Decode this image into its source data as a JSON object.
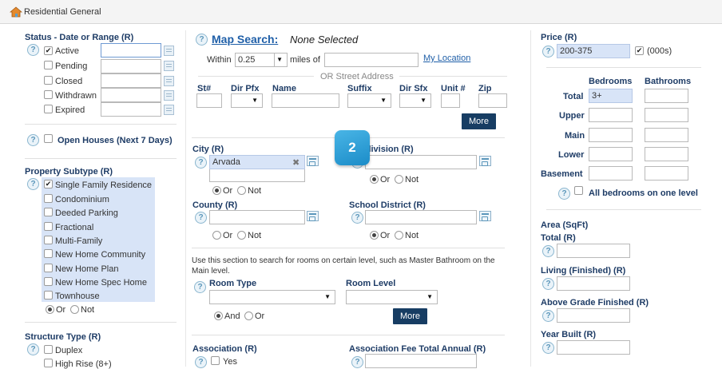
{
  "page": {
    "title": "Residential General"
  },
  "status": {
    "heading": "Status - Date or Range (R)",
    "items": [
      {
        "label": "Active",
        "checked": true
      },
      {
        "label": "Pending",
        "checked": false
      },
      {
        "label": "Closed",
        "checked": false
      },
      {
        "label": "Withdrawn",
        "checked": false
      },
      {
        "label": "Expired",
        "checked": false
      }
    ],
    "open_houses": "Open Houses (Next 7 Days)"
  },
  "subtype": {
    "heading": "Property Subtype (R)",
    "items": [
      {
        "label": "Single Family Residence",
        "checked": true
      },
      {
        "label": "Condominium",
        "checked": false
      },
      {
        "label": "Deeded Parking",
        "checked": false
      },
      {
        "label": "Fractional",
        "checked": false
      },
      {
        "label": "Multi-Family",
        "checked": false
      },
      {
        "label": "New Home Community",
        "checked": false
      },
      {
        "label": "New Home Plan",
        "checked": false
      },
      {
        "label": "New Home Spec Home",
        "checked": false
      },
      {
        "label": "Townhouse",
        "checked": false
      }
    ],
    "or": "Or",
    "not": "Not"
  },
  "structure": {
    "heading": "Structure Type (R)",
    "items": [
      {
        "label": "Duplex",
        "checked": false
      },
      {
        "label": "High Rise (8+)",
        "checked": false
      }
    ]
  },
  "map": {
    "link": "Map Search:",
    "selection": "None Selected",
    "within": "Within",
    "distance": "0.25",
    "miles_of": "miles of",
    "my_location": "My Location",
    "or_street": "OR Street Address",
    "cols": [
      "St#",
      "Dir Pfx",
      "Name",
      "Suffix",
      "Dir Sfx",
      "Unit #",
      "Zip"
    ],
    "more": "More"
  },
  "city": {
    "heading": "City (R)",
    "value": "Arvada",
    "or": "Or",
    "not": "Not"
  },
  "subdivision": {
    "heading": "Subdivision (R)",
    "or": "Or",
    "not": "Not"
  },
  "county": {
    "heading": "County (R)",
    "or": "Or",
    "not": "Not"
  },
  "school": {
    "heading": "School District (R)",
    "or": "Or",
    "not": "Not"
  },
  "rooms": {
    "note": "Use this section to search for rooms on certain level, such as Master Bathroom on the Main level.",
    "room_type": "Room Type",
    "room_level": "Room Level",
    "and": "And",
    "or": "Or",
    "more": "More"
  },
  "association": {
    "heading": "Association (R)",
    "yes": "Yes"
  },
  "assoc_fee": {
    "heading": "Association Fee Total Annual (R)"
  },
  "price": {
    "heading": "Price (R)",
    "value": "200-375",
    "units": "(000s)",
    "units_checked": true
  },
  "beds": {
    "col_bed": "Bedrooms",
    "col_bath": "Bathrooms",
    "rows": [
      "Total",
      "Upper",
      "Main",
      "Lower",
      "Basement"
    ],
    "total_bed": "3+",
    "all_one_level": "All bedrooms on one level"
  },
  "area": {
    "heading": "Area (SqFt)",
    "total": "Total (R)",
    "living": "Living (Finished) (R)",
    "above": "Above Grade Finished (R)"
  },
  "year": {
    "heading": "Year Built (R)"
  },
  "step_badge": "2",
  "colors": {
    "accent": "#1e3c66",
    "link": "#1f5fa8",
    "highlight": "#d8e4f7",
    "button": "#173d63"
  }
}
